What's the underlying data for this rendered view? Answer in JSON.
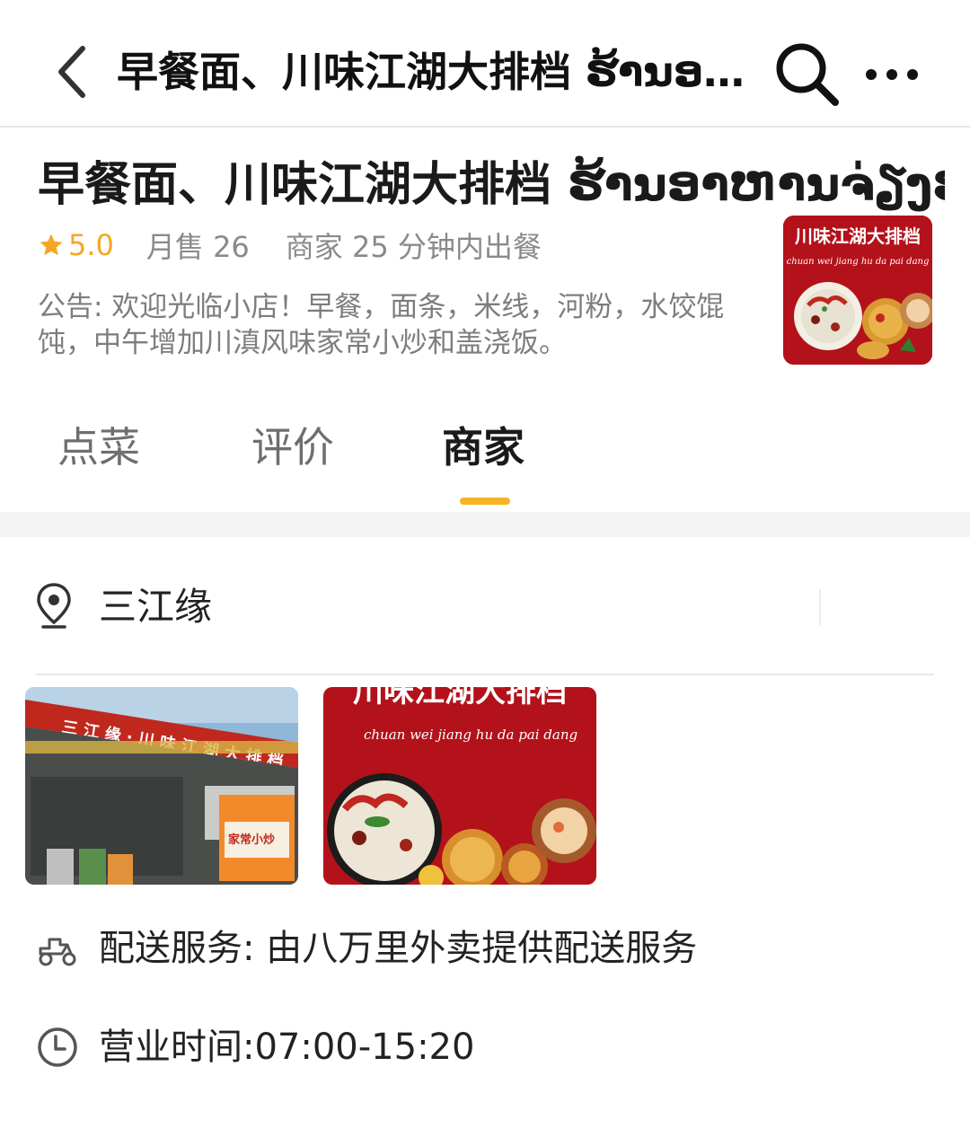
{
  "nav": {
    "title": "早餐面、川味江湖大排档 ຮ້ານອາ...",
    "back_icon": "chevron-left-icon",
    "search_icon": "search-icon",
    "more_icon": "more-dots-icon"
  },
  "store": {
    "name": "早餐面、川味江湖大排档 ຮ້ານອາຫານຈ່ຽງຮູ",
    "rating": "5.0",
    "monthly_sales": "月售 26",
    "prep_time": "商家 25 分钟内出餐",
    "notice": "公告: 欢迎光临小店！早餐，面条，米线，河粉，水饺馄饨，中午增加川滇风味家常小炒和盖浇饭。",
    "logo_text": "川味江湖大排档",
    "logo_subtext": "chuan wei jiang hu da pai dang"
  },
  "tabs": [
    {
      "label": "点菜",
      "active": false
    },
    {
      "label": "评价",
      "active": false
    },
    {
      "label": "商家",
      "active": true
    }
  ],
  "merchant": {
    "address": "三江缘",
    "photos": [
      {
        "caption": "storefront-photo",
        "sign_text": "三 江 缘 · 川 味 江 湖 大 排 档",
        "board_text": "家常小炒"
      },
      {
        "caption": "food-banner-photo",
        "banner_title": "川味江湖大排档",
        "banner_subtitle": "chuan wei jiang hu da pai dang"
      }
    ],
    "delivery": "配送服务:  由八万里外卖提供配送服务",
    "hours": "营业时间:07:00-15:20"
  },
  "colors": {
    "accent": "#f5b325",
    "rating": "#f5a623",
    "brand_red": "#b3121a"
  }
}
